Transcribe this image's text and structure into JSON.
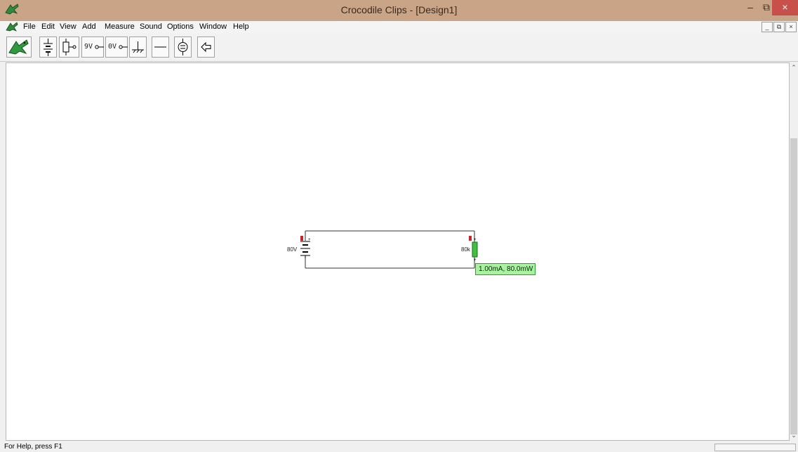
{
  "window": {
    "title": "Crocodile Clips - [Design1]",
    "minimize_glyph": "–",
    "restore_glyph": "⧉",
    "close_glyph": "×",
    "colors": {
      "titlebar": "#caa487",
      "close": "#c7504a"
    }
  },
  "menu": {
    "items": [
      "File",
      "Edit",
      "View",
      "Add",
      "Measure",
      "Sound",
      "Options",
      "Window",
      "Help"
    ],
    "mdi_buttons": [
      "_",
      "⧉",
      "×"
    ]
  },
  "toolbar": {
    "tools": [
      {
        "name": "crocodile-logo-icon"
      },
      {
        "name": "battery-icon"
      },
      {
        "name": "power-supply-icon"
      },
      {
        "name": "9v-terminal-icon",
        "label": "9V"
      },
      {
        "name": "0v-terminal-icon",
        "label": "0V"
      },
      {
        "name": "ground-icon"
      },
      {
        "name": "wire-icon"
      },
      {
        "name": "current-source-icon"
      },
      {
        "name": "back-arrow-icon"
      }
    ]
  },
  "circuit": {
    "battery_label": "80V",
    "resistor_label": "80k",
    "readout": "1.00mA, 80.0mW",
    "colors": {
      "resistor": "#3fc03f",
      "probe": "#c0282a",
      "readout_bg": "#a8f2a0"
    }
  },
  "status": {
    "text": "For Help, press F1"
  }
}
